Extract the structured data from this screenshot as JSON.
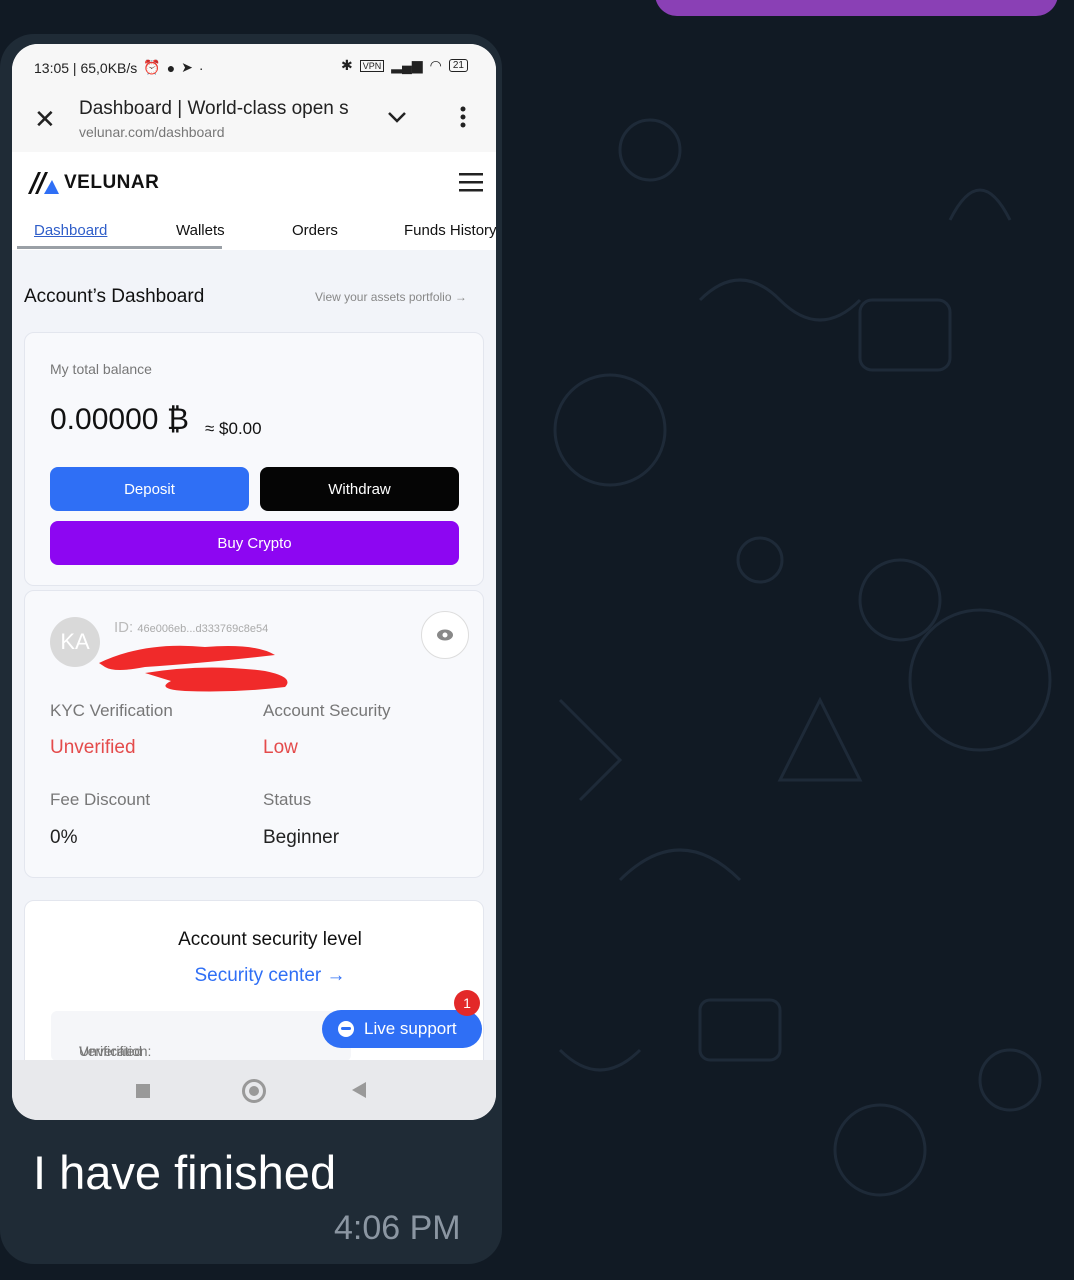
{
  "status_bar": {
    "time_speed": "13:05 | 65,0KB/s",
    "battery": "21"
  },
  "browser": {
    "page_title": "Dashboard | World-class open s",
    "url": "velunar.com/dashboard"
  },
  "site": {
    "logo": "VELUNAR",
    "tabs": [
      "Dashboard",
      "Wallets",
      "Orders",
      "Funds History"
    ]
  },
  "dashboard": {
    "heading": "Account’s Dashboard",
    "portfolio_link": "View your assets portfolio →",
    "balance_label": "My total balance",
    "balance": "0.00000 ₿",
    "balance_usd": "≈ $0.00",
    "deposit": "Deposit",
    "withdraw": "Withdraw",
    "buy_crypto": "Buy Crypto"
  },
  "profile": {
    "avatar_initials": "KA",
    "id_label": "ID:",
    "id_value": "46e006eb...d333769c8e54",
    "kyc_label": "KYC Verification",
    "kyc_value": "Unverified",
    "security_label": "Account Security",
    "security_value": "Low",
    "fee_label": "Fee Discount",
    "fee_value": "0%",
    "status_label": "Status",
    "status_value": "Beginner"
  },
  "security_card": {
    "title": "Account security level",
    "link": "Security center →",
    "verification_label": "Verification:",
    "verification_value": "Unverified"
  },
  "live_support": {
    "label": "Live support",
    "badge": "1"
  },
  "message": {
    "text": "I have finished",
    "time": "4:06 PM"
  },
  "colors": {
    "accent_blue": "#2f6ff5",
    "buy_purple": "#8d06f2",
    "alert_red": "#e44b4b",
    "chat_bg": "#111a24"
  }
}
